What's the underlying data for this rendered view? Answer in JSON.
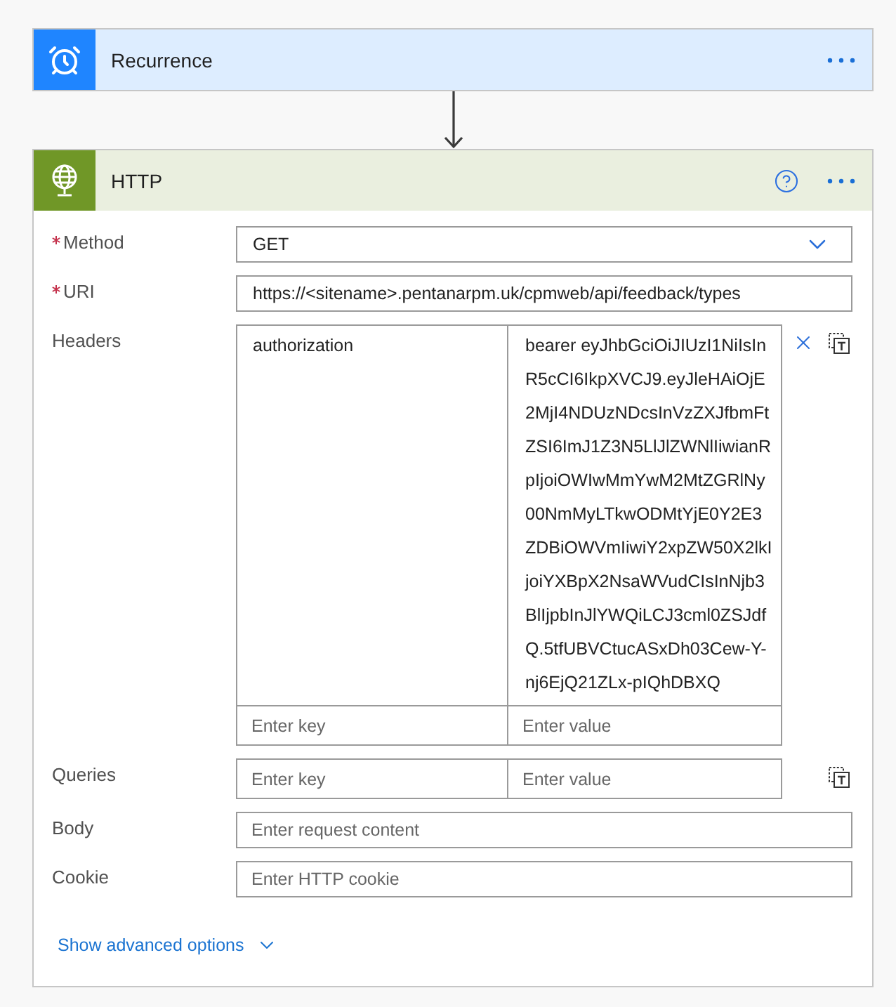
{
  "steps": [
    {
      "kind": "schedule",
      "title": "Recurrence",
      "color": "#1f85ff",
      "help": false
    },
    {
      "kind": "http",
      "title": "HTTP",
      "color": "#709727",
      "help": true,
      "fields": [
        {
          "kind": "dropdown",
          "label": "Method",
          "required": true,
          "value": "GET"
        },
        {
          "kind": "text",
          "label": "URI",
          "required": true,
          "value": "https://<sitename>.pentanarpm.uk/cpmweb/api/feedback/types"
        },
        {
          "kind": "key_value",
          "label": "Headers",
          "required": false,
          "rows": [
            {
              "key": "authorization",
              "value": "bearer eyJhbGciOiJIUzI1NiIsInR5cCI6IkpXVCJ9.eyJleHAiOjE2MjI4NDUzNDcsInVzZXJfbmFtZSI6ImJ1Z3N5LlJlZWNlIiwianRpIjoiOWIwMmYwM2MtZGRlNy00NmMyLTkwODMtYjE0Y2E3ZDBiOWVmIiwiY2xpZW50X2lkIjoiYXBpX2NsaWVudCIsInNjb3BlIjpbInJlYWQiLCJ3cml0ZSJdfQ.5tfUBVCtucASxDh03Cew-Y-nj6EjQ21ZLx-pIQhDBXQ"
            }
          ],
          "key_placeholder": "Enter key",
          "value_placeholder": "Enter value"
        },
        {
          "kind": "key_value",
          "label": "Queries",
          "required": false,
          "key_placeholder": "Enter key",
          "value_placeholder": "Enter value"
        },
        {
          "kind": "text",
          "label": "Body",
          "required": false,
          "placeholder": "Enter request content"
        },
        {
          "kind": "text",
          "label": "Cookie",
          "required": false,
          "placeholder": "Enter HTTP cookie"
        }
      ],
      "advanced_link": "Show advanced options"
    }
  ]
}
